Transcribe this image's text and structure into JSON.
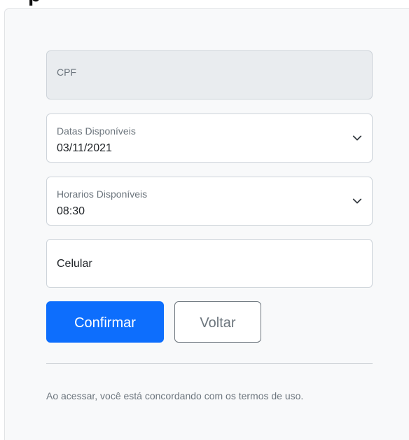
{
  "form": {
    "cpf": {
      "label": "CPF",
      "value": "",
      "disabled": true
    },
    "datas": {
      "label": "Datas Disponíveis",
      "selected": "03/11/2021",
      "icon": "chevron-down-icon"
    },
    "horarios": {
      "label": "Horarios Disponíveis",
      "selected": "08:30",
      "icon": "chevron-down-icon"
    },
    "celular": {
      "label": "Celular",
      "value": ""
    }
  },
  "actions": {
    "confirm_label": "Confirmar",
    "back_label": "Voltar"
  },
  "footer": {
    "terms_text": "Ao acessar, você está concordando com os termos de uso."
  },
  "colors": {
    "primary": "#0d6efd",
    "secondary": "#6c757d",
    "card_background": "#f8f9fa",
    "disabled_field": "#e9ecef"
  }
}
